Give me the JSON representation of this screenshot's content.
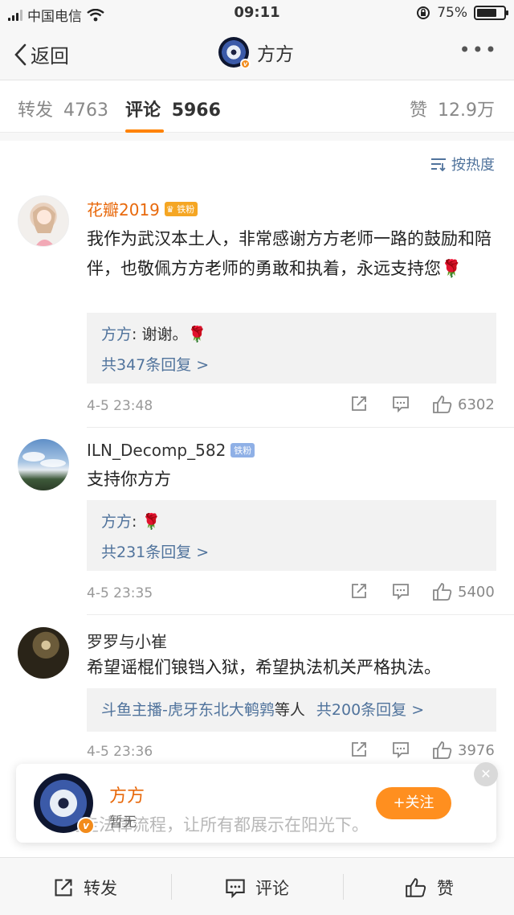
{
  "status_bar": {
    "carrier": "中国电信",
    "time": "09:11",
    "battery": "75%",
    "battery_level": 0.75
  },
  "nav": {
    "back_label": "返回",
    "title": "方方",
    "more_icon": "more-icon"
  },
  "tabs": [
    {
      "label": "转发",
      "count": "4763"
    },
    {
      "label": "评论",
      "count": "5966"
    },
    {
      "label": "赞",
      "count": "12.9万"
    }
  ],
  "sort_label": "按热度",
  "comments": [
    {
      "user": "花瓣2019",
      "badge": "铁粉",
      "text": "我作为武汉本土人，非常感谢方方老师一路的鼓励和陪伴，也敬佩方方老师的勇敢和执着，永远支持您🌹",
      "reply_user": "方方",
      "reply_text": ": 谢谢。🌹",
      "reply_more": "共347条回复 >",
      "time": "4-5 23:48",
      "likes": "6302"
    },
    {
      "user": "ILN_Decomp_582",
      "badge": "铁粉",
      "text": "支持你方方",
      "reply_user": "方方",
      "reply_text": ": 🌹",
      "reply_more": "共231条回复 >",
      "time": "4-5 23:35",
      "likes": "5400"
    },
    {
      "user": "罗罗与小崔",
      "text": "希望谣棍们锒铛入狱，希望执法机关严格执法。",
      "reply_names": "斗鱼主播-虎牙东北大鹌鹑",
      "reply_mid": "等人",
      "reply_more": "共200条回复 >",
      "time": "4-5 23:36",
      "likes": "3976"
    }
  ],
  "popup": {
    "name": "方方",
    "subtitle": "暂无",
    "follow_label": "+关注",
    "close_icon": "close-icon",
    "ghost_text": "一切走法律流程，让所有都展示在阳光下。"
  },
  "bottom_bar": {
    "repost": "转发",
    "comment": "评论",
    "like": "赞"
  },
  "colors": {
    "accent": "#ff8200",
    "link": "#50739c",
    "username": "#e8690c"
  }
}
